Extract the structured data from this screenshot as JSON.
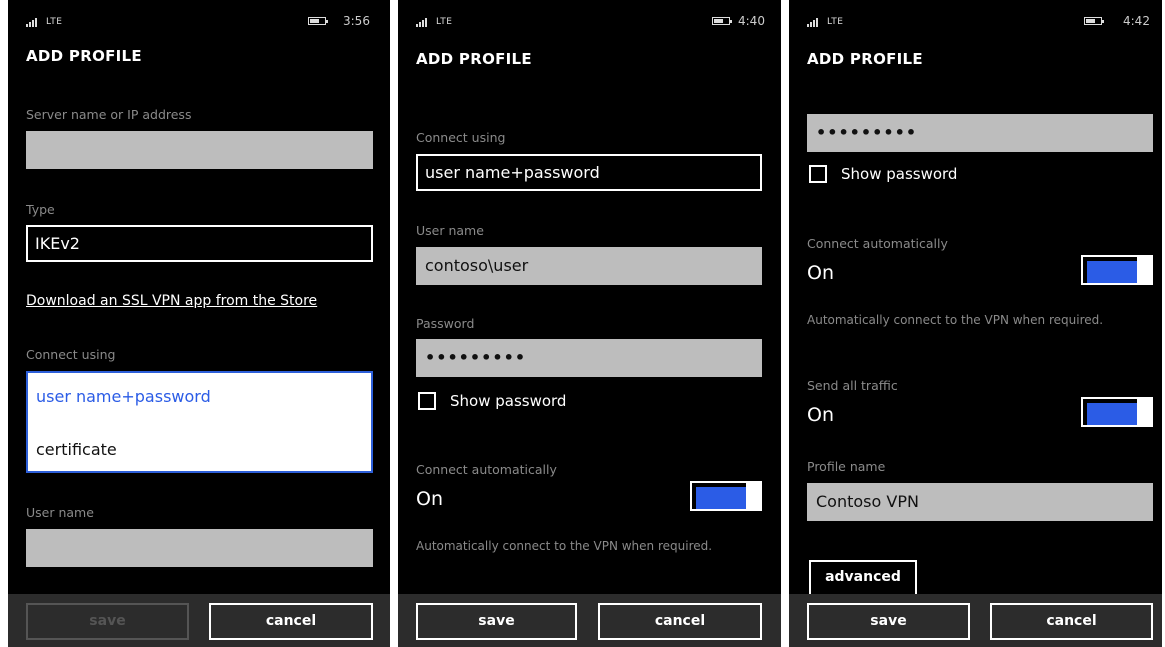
{
  "screens": [
    {
      "status": {
        "network": "LTE",
        "time": "3:56"
      },
      "title": "ADD PROFILE",
      "server_label": "Server name or IP address",
      "server_value": "",
      "type_label": "Type",
      "type_value": "IKEv2",
      "store_link": "Download an SSL VPN app from the Store",
      "connect_using_label": "Connect using",
      "connect_options": [
        "user name+password",
        "certificate"
      ],
      "username_label": "User name",
      "username_value": "",
      "save": "save",
      "cancel": "cancel"
    },
    {
      "status": {
        "network": "LTE",
        "time": "4:40"
      },
      "title": "ADD PROFILE",
      "connect_using_label": "Connect using",
      "connect_using_value": "user name+password",
      "username_label": "User name",
      "username_value": "contoso\\user",
      "password_label": "Password",
      "password_value": "•••••••••",
      "show_password": "Show password",
      "auto_label": "Connect automatically",
      "auto_value": "On",
      "auto_desc": "Automatically connect to the VPN when required.",
      "save": "save",
      "cancel": "cancel"
    },
    {
      "status": {
        "network": "LTE",
        "time": "4:42"
      },
      "title": "ADD PROFILE",
      "password_value": "•••••••••",
      "show_password": "Show password",
      "auto_label": "Connect automatically",
      "auto_value": "On",
      "auto_desc": "Automatically connect to the VPN when required.",
      "traffic_label": "Send all traffic",
      "traffic_value": "On",
      "profile_label": "Profile name",
      "profile_value": "Contoso VPN",
      "advanced": "advanced",
      "save": "save",
      "cancel": "cancel"
    }
  ],
  "colors": {
    "accent": "#2b5ce6",
    "field": "#bdbdbd",
    "appbar": "#2c2c2c",
    "label": "#8a8a8a"
  }
}
